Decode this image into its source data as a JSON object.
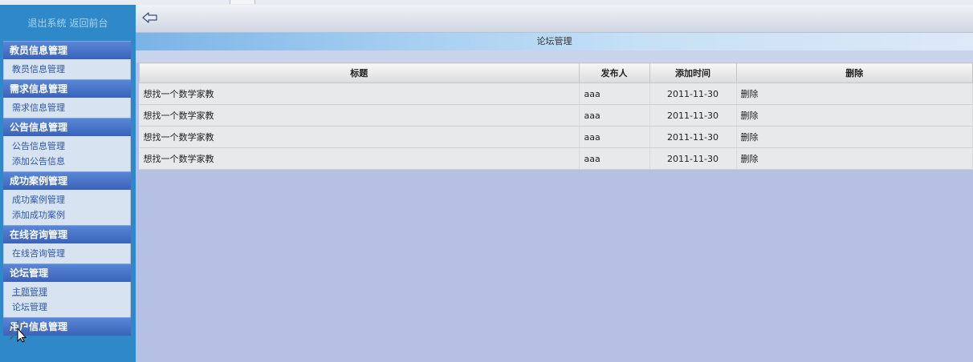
{
  "sidebar": {
    "logout": "退出系统",
    "home": "返回前台",
    "groups": [
      {
        "header": "教员信息管理",
        "items": [
          "教员信息管理"
        ]
      },
      {
        "header": "需求信息管理",
        "items": [
          "需求信息管理"
        ]
      },
      {
        "header": "公告信息管理",
        "items": [
          "公告信息管理",
          "添加公告信息"
        ]
      },
      {
        "header": "成功案例管理",
        "items": [
          "成功案例管理",
          "添加成功案例"
        ]
      },
      {
        "header": "在线咨询管理",
        "items": [
          "在线咨询管理"
        ]
      },
      {
        "header": "论坛管理",
        "items": [
          "主题管理",
          "论坛管理"
        ]
      },
      {
        "header": "用户信息管理",
        "items": []
      }
    ]
  },
  "main": {
    "title": "论坛管理",
    "columns": [
      "标题",
      "发布人",
      "添加时间",
      "删除"
    ],
    "rows": [
      {
        "title": "想找一个数学家教",
        "author": "aaa",
        "date": "2011-11-30",
        "action": "删除"
      },
      {
        "title": "想找一个数学家教",
        "author": "aaa",
        "date": "2011-11-30",
        "action": "删除"
      },
      {
        "title": "想找一个数学家教",
        "author": "aaa",
        "date": "2011-11-30",
        "action": "删除"
      },
      {
        "title": "想找一个数学家教",
        "author": "aaa",
        "date": "2011-11-30",
        "action": "删除"
      }
    ]
  },
  "icons": {
    "back": "back-arrow-icon",
    "cursor": "mouse-pointer-icon"
  },
  "colors": {
    "sidebar": "#2f88c8",
    "group_header": "#3a63b8",
    "content_bg": "#b6c0e4"
  }
}
